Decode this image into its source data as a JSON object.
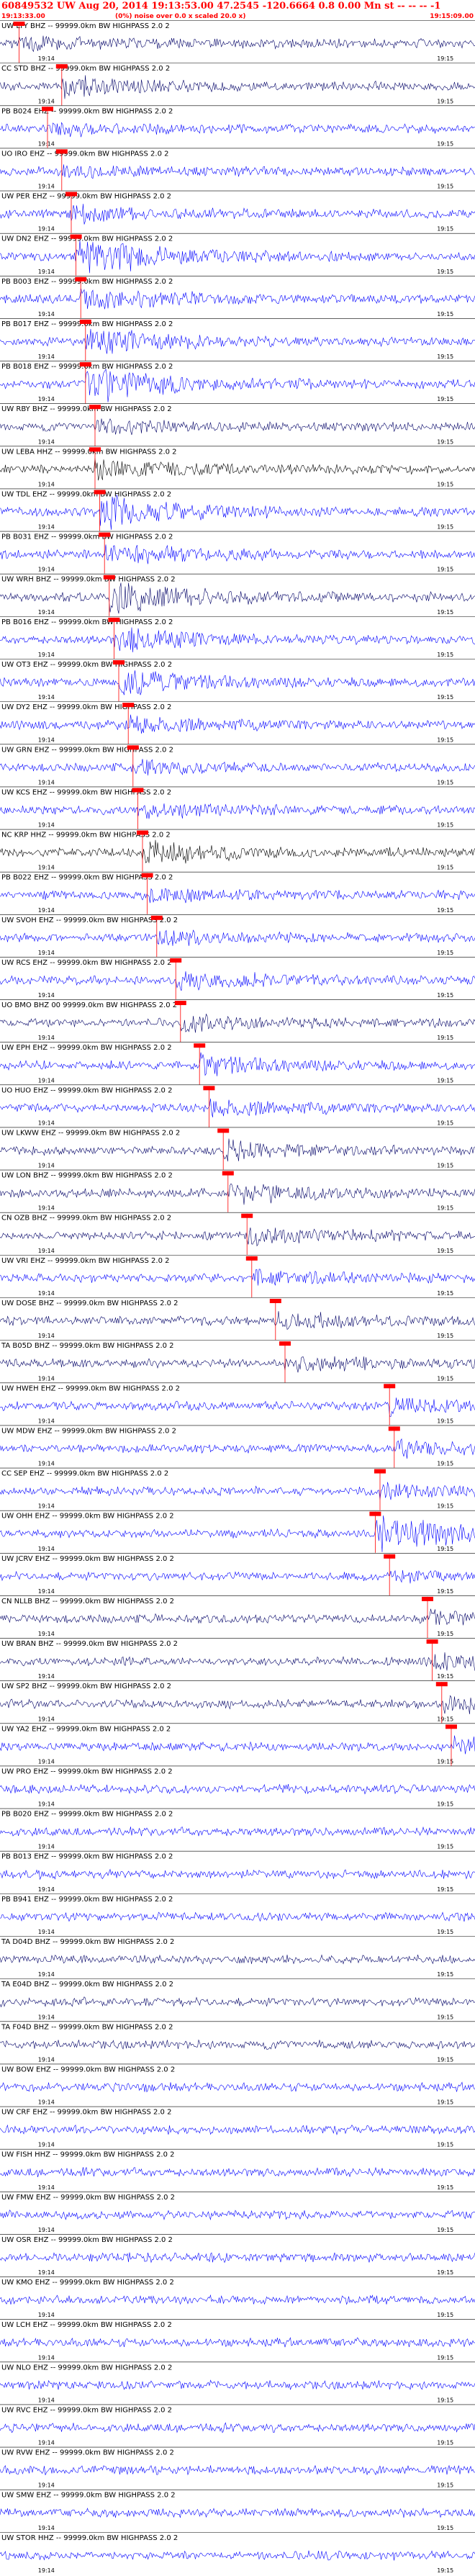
{
  "header": {
    "title": "60849532 UW Aug 20, 2014 19:13:53.00 47.2545 -120.6664 0.8 0.00 Mn st -- -- -- -1",
    "start_time": "19:13:33.00",
    "scale_note": "(0%) noise over 0.0 x scaled 20.0 x)",
    "end_time": "19:15:09.00"
  },
  "chart_data": {
    "type": "line",
    "title": "60849532 UW Aug 20, 2014 19:13:53.00 47.2545 -120.6664 0.8 0.00 Mn st -- -- -- -1",
    "time_ticks": [
      "19:14",
      "19:15"
    ],
    "grid": false,
    "colors": {
      "trace_blue": "#0000ff",
      "trace_dark": "#000066",
      "trace_black": "#000000",
      "pick": "#ff0000"
    },
    "series": [
      {
        "name": "UW LTY BHZ -- 99999.0km BW HIGHPASS 2.0 2",
        "color": "#000066",
        "amp": 0.35,
        "pick": 0.04
      },
      {
        "name": "CC STD BHZ -- 99999.0km BW HIGHPASS 2.0 2",
        "color": "#000066",
        "amp": 0.55,
        "pick": 0.13
      },
      {
        "name": "PB B024 EHZ -- 99999.0km BW HIGHPASS 2.0 2",
        "color": "#0000ff",
        "amp": 0.3,
        "pick": 0.1
      },
      {
        "name": "UO IRO EHZ -- 99999.0km BW HIGHPASS 2.0 2",
        "color": "#0000ff",
        "amp": 0.25,
        "pick": 0.13
      },
      {
        "name": "UW PER EHZ -- 99999.0km BW HIGHPASS 2.0 2",
        "color": "#0000ff",
        "amp": 0.4,
        "pick": 0.15
      },
      {
        "name": "UW DN2 EHZ -- 99999.0km BW HIGHPASS 2.0 2",
        "color": "#0000ff",
        "amp": 0.95,
        "pick": 0.16
      },
      {
        "name": "PB B003 EHZ -- 99999.0km BW HIGHPASS 2.0 2",
        "color": "#0000ff",
        "amp": 0.6,
        "pick": 0.17
      },
      {
        "name": "PB B017 EHZ -- 99999.0km BW HIGHPASS 2.0 2",
        "color": "#0000ff",
        "amp": 0.65,
        "pick": 0.18
      },
      {
        "name": "PB B018 EHZ -- 99999.0km BW HIGHPASS 2.0 2",
        "color": "#0000ff",
        "amp": 0.95,
        "pick": 0.18
      },
      {
        "name": "UW RBY BHZ -- 99999.0km BW HIGHPASS 2.0 2",
        "color": "#000066",
        "amp": 0.3,
        "pick": 0.2
      },
      {
        "name": "UW LEBA HHZ -- 99999.0km BW HIGHPASS 2.0 2",
        "color": "#000000",
        "amp": 0.55,
        "pick": 0.2
      },
      {
        "name": "UW TDL EHZ -- 99999.0km BW HIGHPASS 2.0 2",
        "color": "#0000ff",
        "amp": 0.9,
        "pick": 0.21
      },
      {
        "name": "PB B031 EHZ -- 99999.0km BW HIGHPASS 2.0 2",
        "color": "#0000ff",
        "amp": 0.55,
        "pick": 0.22
      },
      {
        "name": "UW WRH BHZ -- 99999.0km BW HIGHPASS 2.0 2",
        "color": "#000066",
        "amp": 0.9,
        "pick": 0.23
      },
      {
        "name": "PB B016 EHZ -- 99999.0km BW HIGHPASS 2.0 2",
        "color": "#0000ff",
        "amp": 0.6,
        "pick": 0.24
      },
      {
        "name": "UW OT3 EHZ -- 99999.0km BW HIGHPASS 2.0 2",
        "color": "#0000ff",
        "amp": 0.7,
        "pick": 0.25
      },
      {
        "name": "UW DY2 EHZ -- 99999.0km BW HIGHPASS 2.0 2",
        "color": "#0000ff",
        "amp": 0.4,
        "pick": 0.27
      },
      {
        "name": "UW GRN EHZ -- 99999.0km BW HIGHPASS 2.0 2",
        "color": "#0000ff",
        "amp": 0.35,
        "pick": 0.28
      },
      {
        "name": "UW KCS EHZ -- 99999.0km BW HIGHPASS 2.0 2",
        "color": "#0000ff",
        "amp": 0.4,
        "pick": 0.29
      },
      {
        "name": "NC KRP HHZ -- 99999.0km BW HIGHPASS 2.0 2",
        "color": "#000000",
        "amp": 0.55,
        "pick": 0.3
      },
      {
        "name": "PB B022 EHZ -- 99999.0km BW HIGHPASS 2.0 2",
        "color": "#0000ff",
        "amp": 0.3,
        "pick": 0.31
      },
      {
        "name": "UW SVOH EHZ -- 99999.0km BW HIGHPASS 2.0 2",
        "color": "#0000ff",
        "amp": 0.3,
        "pick": 0.33
      },
      {
        "name": "UW RCS EHZ -- 99999.0km BW HIGHPASS 2.0 2",
        "color": "#0000ff",
        "amp": 0.45,
        "pick": 0.37
      },
      {
        "name": "UO BMO BHZ 00 99999.0km BW HIGHPASS 2.0 2",
        "color": "#000066",
        "amp": 0.35,
        "pick": 0.38
      },
      {
        "name": "UW EPH EHZ -- 99999.0km BW HIGHPASS 2.0 2",
        "color": "#0000ff",
        "amp": 0.5,
        "pick": 0.42
      },
      {
        "name": "UO HUO EHZ -- 99999.0km BW HIGHPASS 2.0 2",
        "color": "#0000ff",
        "amp": 0.4,
        "pick": 0.44
      },
      {
        "name": "UW LKWW EHZ -- 99999.0km BW HIGHPASS 2.0 2",
        "color": "#000066",
        "amp": 0.45,
        "pick": 0.47
      },
      {
        "name": "UW LON BHZ -- 99999.0km BW HIGHPASS 2.0 2",
        "color": "#000066",
        "amp": 0.55,
        "pick": 0.48
      },
      {
        "name": "CN OZB BHZ -- 99999.0km BW HIGHPASS 2.0 2",
        "color": "#000066",
        "amp": 0.45,
        "pick": 0.52
      },
      {
        "name": "UW VRI EHZ -- 99999.0km BW HIGHPASS 2.0 2",
        "color": "#0000ff",
        "amp": 0.35,
        "pick": 0.53
      },
      {
        "name": "UW DOSE BHZ -- 99999.0km BW HIGHPASS 2.0 2",
        "color": "#000066",
        "amp": 0.45,
        "pick": 0.58
      },
      {
        "name": "TA B05D BHZ -- 99999.0km BW HIGHPASS 2.0 2",
        "color": "#000066",
        "amp": 0.4,
        "pick": 0.6
      },
      {
        "name": "UW HWEH EHZ -- 99999.0km BW HIGHPASS 2.0 2",
        "color": "#0000ff",
        "amp": 0.35,
        "pick": 0.82
      },
      {
        "name": "UW MDW EHZ -- 99999.0km BW HIGHPASS 2.0 2",
        "color": "#0000ff",
        "amp": 0.4,
        "pick": 0.83
      },
      {
        "name": "CC SEP EHZ -- 99999.0km BW HIGHPASS 2.0 2",
        "color": "#0000ff",
        "amp": 0.35,
        "pick": 0.8
      },
      {
        "name": "UW OHH EHZ -- 99999.0km BW HIGHPASS 2.0 2",
        "color": "#0000ff",
        "amp": 0.95,
        "pick": 0.79
      },
      {
        "name": "UW JCRV EHZ -- 99999.0km BW HIGHPASS 2.0 2",
        "color": "#0000ff",
        "amp": 0.2,
        "pick": 0.82
      },
      {
        "name": "CN NLLB BHZ -- 99999.0km BW HIGHPASS 2.0 2",
        "color": "#000066",
        "amp": 0.35,
        "pick": 0.9
      },
      {
        "name": "UW BRAN BHZ -- 99999.0km BW HIGHPASS 2.0 2",
        "color": "#000066",
        "amp": 0.45,
        "pick": 0.91
      },
      {
        "name": "UW SP2 BHZ -- 99999.0km BW HIGHPASS 2.0 2",
        "color": "#000066",
        "amp": 0.45,
        "pick": 0.93
      },
      {
        "name": "UW YA2 EHZ -- 99999.0km BW HIGHPASS 2.0 2",
        "color": "#0000ff",
        "amp": 0.35,
        "pick": 0.95
      },
      {
        "name": "UW PRO EHZ -- 99999.0km BW HIGHPASS 2.0 2",
        "color": "#0000ff",
        "amp": 0.35,
        "pick": null
      },
      {
        "name": "PB B020 EHZ -- 99999.0km BW HIGHPASS 2.0 2",
        "color": "#0000ff",
        "amp": 0.3,
        "pick": null
      },
      {
        "name": "PB B013 EHZ -- 99999.0km BW HIGHPASS 2.0 2",
        "color": "#0000ff",
        "amp": 0.3,
        "pick": null
      },
      {
        "name": "PB B941 EHZ -- 99999.0km BW HIGHPASS 2.0 2",
        "color": "#0000ff",
        "amp": 0.3,
        "pick": null
      },
      {
        "name": "TA D04D BHZ -- 99999.0km BW HIGHPASS 2.0 2",
        "color": "#000066",
        "amp": 0.35,
        "pick": null
      },
      {
        "name": "TA E04D BHZ -- 99999.0km BW HIGHPASS 2.0 2",
        "color": "#000066",
        "amp": 0.4,
        "pick": null
      },
      {
        "name": "TA F04D BHZ -- 99999.0km BW HIGHPASS 2.0 2",
        "color": "#000066",
        "amp": 0.4,
        "pick": null
      },
      {
        "name": "UW BOW EHZ -- 99999.0km BW HIGHPASS 2.0 2",
        "color": "#0000ff",
        "amp": 0.35,
        "pick": null
      },
      {
        "name": "UW CRF EHZ -- 99999.0km BW HIGHPASS 2.0 2",
        "color": "#0000ff",
        "amp": 0.3,
        "pick": null
      },
      {
        "name": "UW FISH HHZ -- 99999.0km BW HIGHPASS 2.0 2",
        "color": "#0000ff",
        "amp": 0.3,
        "pick": null
      },
      {
        "name": "UW FMW EHZ -- 99999.0km BW HIGHPASS 2.0 2",
        "color": "#0000ff",
        "amp": 0.3,
        "pick": null
      },
      {
        "name": "UW OSR EHZ -- 99999.0km BW HIGHPASS 2.0 2",
        "color": "#0000ff",
        "amp": 0.3,
        "pick": null
      },
      {
        "name": "UW KMO EHZ -- 99999.0km BW HIGHPASS 2.0 2",
        "color": "#0000ff",
        "amp": 0.3,
        "pick": null
      },
      {
        "name": "UW LCH EHZ -- 99999.0km BW HIGHPASS 2.0 2",
        "color": "#0000ff",
        "amp": 0.3,
        "pick": null
      },
      {
        "name": "UW NLO EHZ -- 99999.0km BW HIGHPASS 2.0 2",
        "color": "#0000ff",
        "amp": 0.3,
        "pick": null
      },
      {
        "name": "UW RVC EHZ -- 99999.0km BW HIGHPASS 2.0 2",
        "color": "#0000ff",
        "amp": 0.3,
        "pick": null
      },
      {
        "name": "UW RVW EHZ -- 99999.0km BW HIGHPASS 2.0 2",
        "color": "#0000ff",
        "amp": 0.3,
        "pick": null
      },
      {
        "name": "UW SMW EHZ -- 99999.0km BW HIGHPASS 2.0 2",
        "color": "#0000ff",
        "amp": 0.3,
        "pick": null
      },
      {
        "name": "UW STOR HHZ -- 99999.0km BW HIGHPASS 2.0 2",
        "color": "#0000ff",
        "amp": 0.3,
        "pick": null
      }
    ]
  }
}
